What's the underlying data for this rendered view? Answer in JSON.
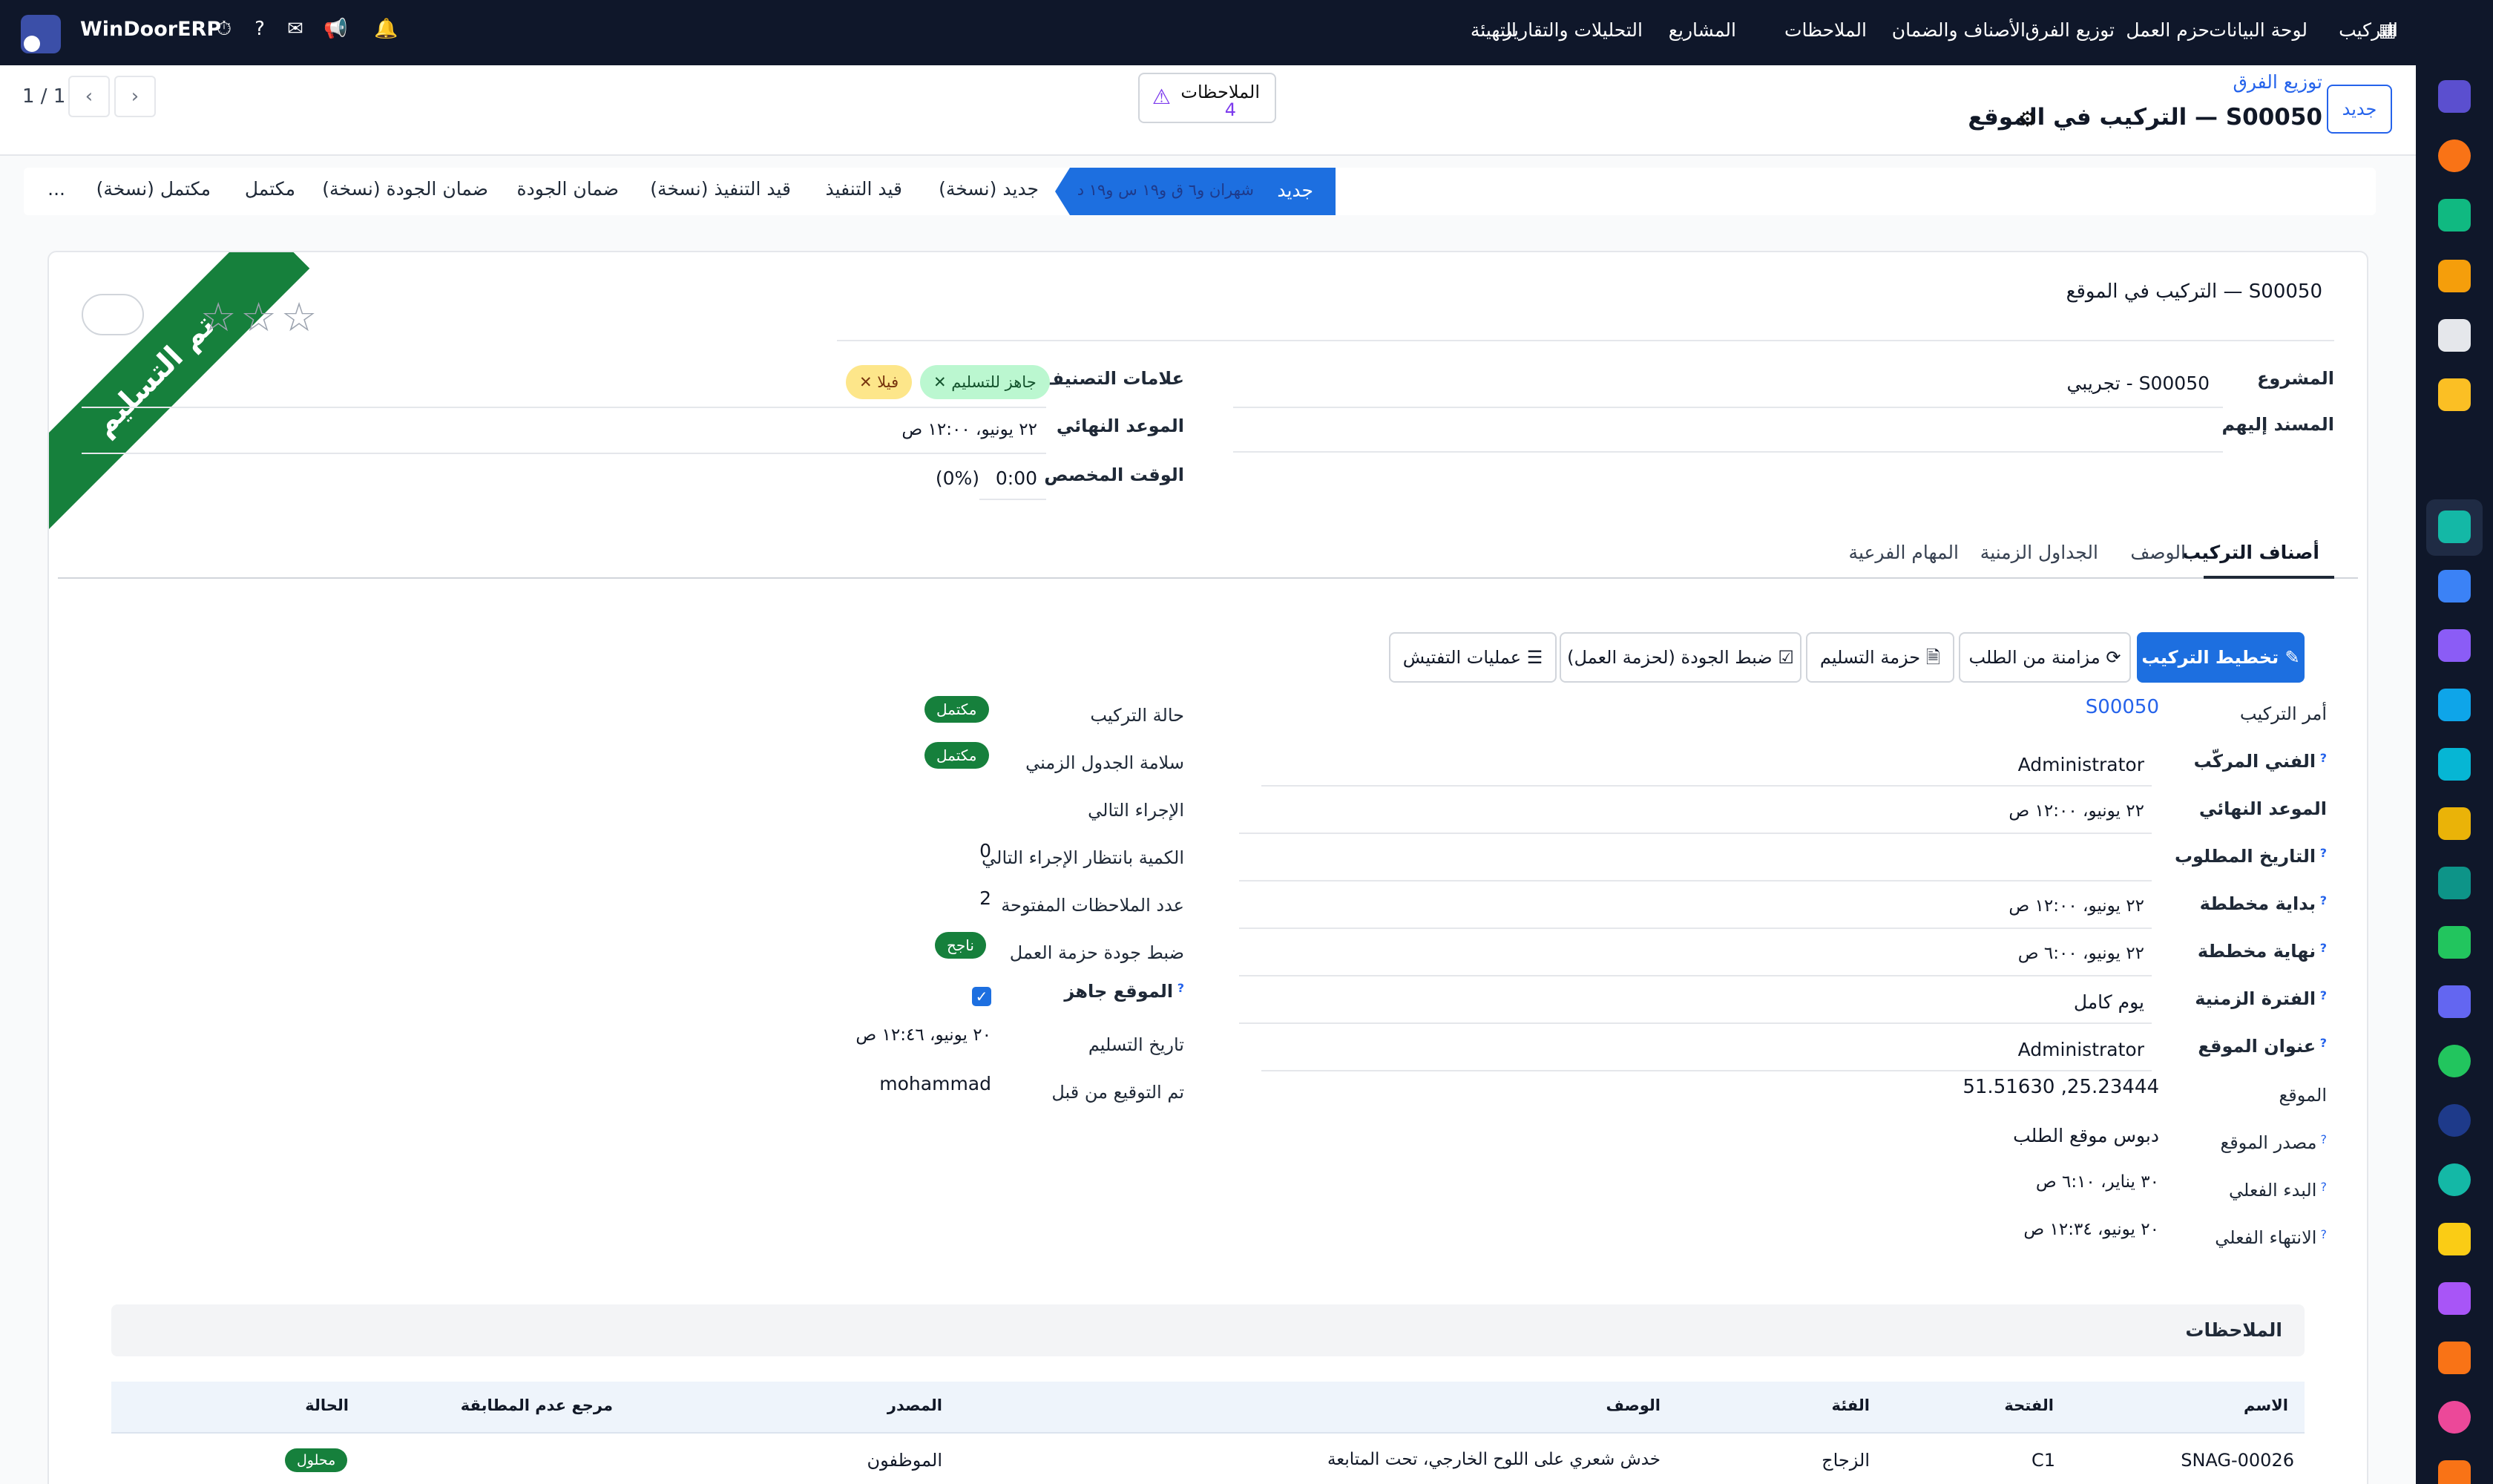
{
  "app": {
    "brand": "WinDoorERP",
    "menu": [
      "التركيب",
      "لوحة البيانات",
      "حزم العمل",
      "توزيع الفرق",
      "الأصناف والضمان",
      "الملاحظات",
      "المشاريع",
      "التحليلات والتقارير",
      "التهيئة"
    ]
  },
  "header": {
    "new_button": "جديد",
    "breadcrumb_parent": "توزيع الفرق",
    "title": "التركيب في الموقع — S00050",
    "notes_label": "الملاحظات",
    "notes_count": "4",
    "pager": "1 / 1"
  },
  "stages": {
    "active_label": "جديد",
    "active_note": "شهران و٦ ق و١٩ س و١٩ د",
    "items": [
      "جديد (نسخة)",
      "قيد التنفيذ",
      "قيد التنفيذ (نسخة)",
      "ضمان الجودة",
      "ضمان الجودة (نسخة)",
      "مكتمل",
      "مكتمل (نسخة)",
      "..."
    ]
  },
  "form": {
    "ribbon": "تم التسليم",
    "name": "التركيب في الموقع — S00050",
    "fields": {
      "project_label": "المشروع",
      "project_value": "تجريبي - S00050",
      "assignees_label": "المسند إليهم",
      "tags_label": "علامات التصنيف",
      "tag1": "جاهز للتسليم",
      "tag2": "فيلا",
      "deadline_label": "الموعد النهائي",
      "deadline_value": "٢٢ يونيو، ١٢:٠٠ ص",
      "allocated_label": "الوقت المخصص",
      "allocated_value": "0:00",
      "allocated_pct": "(0%)"
    }
  },
  "tabs": [
    "أصناف التركيب",
    "الوصف",
    "الجداول الزمنية",
    "المهام الفرعية"
  ],
  "actions": [
    "تخطيط التركيب",
    "مزامنة من الطلب",
    "حزمة التسليم",
    "ضبط الجودة (لحزمة العمل)",
    "عمليات التفتيش"
  ],
  "right_fields": [
    {
      "label": "أمر التركيب",
      "value": "S00050"
    },
    {
      "label": "الفني المركّب",
      "value": "Administrator"
    },
    {
      "label": "الموعد النهائي",
      "value": "٢٢ يونيو، ١٢:٠٠ ص"
    },
    {
      "label": "التاريخ المطلوب",
      "value": ""
    },
    {
      "label": "بداية مخططة",
      "value": "٢٢ يونيو، ١٢:٠٠ ص"
    },
    {
      "label": "نهاية مخططة",
      "value": "٢٢ يونيو، ٦:٠٠ ص"
    },
    {
      "label": "الفترة الزمنية",
      "value": "يوم كامل"
    },
    {
      "label": "عنوان الموقع",
      "value": "Administrator"
    },
    {
      "label": "الموقع",
      "value": "51.51630 ,25.23444"
    },
    {
      "label": "مصدر الموقع",
      "value": "دبوس موقع الطلب"
    },
    {
      "label": "البدء الفعلي",
      "value": "٣٠ يناير، ٦:١٠ ص"
    },
    {
      "label": "الانتهاء الفعلي",
      "value": "٢٠ يونيو، ١٢:٣٤ ص"
    }
  ],
  "left_fields": [
    {
      "label": "حالة التركيب",
      "value": "مكتمل"
    },
    {
      "label": "سلامة الجدول الزمني",
      "value": "مكتمل"
    },
    {
      "label": "الإجراء التالي",
      "value": ""
    },
    {
      "label": "الكمية بانتظار الإجراء التالي",
      "value": "0"
    },
    {
      "label": "عدد الملاحظات المفتوحة",
      "value": "2"
    },
    {
      "label": "ضبط جودة حزمة العمل",
      "value": "ناجح"
    },
    {
      "label": "الموقع جاهز",
      "value": "✓"
    },
    {
      "label": "تاريخ التسليم",
      "value": "٢٠ يونيو، ١٢:٤٦ ص"
    },
    {
      "label": "تم التوقيع من قبل",
      "value": "mohammad"
    }
  ],
  "notes_section": {
    "title": "الملاحظات",
    "columns": [
      "الاسم",
      "الفتحة",
      "الفئة",
      "الوصف",
      "المصدر",
      "مرجع عدم المطابقة",
      "الحالة"
    ],
    "rows": [
      [
        "SNAG-00026",
        "C1",
        "الزجاج",
        "خدش شعري على اللوح الخارجي، تحت المتابعة",
        "الموظفون",
        "",
        "محلول"
      ]
    ]
  }
}
